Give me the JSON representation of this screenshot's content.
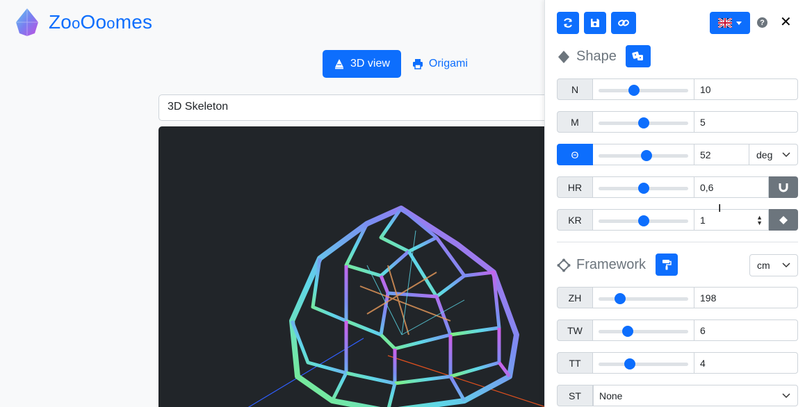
{
  "brand": {
    "name_part1": "Zo",
    "name_part2": "o",
    "name_part3": "Oo",
    "name_part4": "o",
    "name_part5": "mes"
  },
  "tabs": [
    {
      "label": "3D view",
      "active": true
    },
    {
      "label": "Origami",
      "active": false
    }
  ],
  "model_select": {
    "value": "3D Skeleton"
  },
  "panel": {
    "shape_title": "Shape",
    "framework_title": "Framework",
    "framework_unit": "cm",
    "shape_rows": [
      {
        "label": "N",
        "value": "10",
        "slider": 0.38,
        "active": false
      },
      {
        "label": "M",
        "value": "5",
        "slider": 0.5,
        "active": false
      },
      {
        "label": "Θ",
        "value": "52",
        "unit": "deg",
        "slider": 0.54,
        "active": true
      },
      {
        "label": "HR",
        "value": "0,6",
        "slider": 0.5,
        "active": false
      },
      {
        "label": "KR",
        "value": "1",
        "slider": 0.5,
        "active": false
      }
    ],
    "framework_rows": [
      {
        "label": "ZH",
        "value": "198",
        "slider": 0.2
      },
      {
        "label": "TW",
        "value": "6",
        "slider": 0.3
      },
      {
        "label": "TT",
        "value": "4",
        "slider": 0.33
      },
      {
        "label": "ST",
        "value": "None"
      }
    ]
  },
  "colors": {
    "accent": "#0d6efd",
    "secondary": "#6c757d",
    "canvas": "#212529"
  }
}
